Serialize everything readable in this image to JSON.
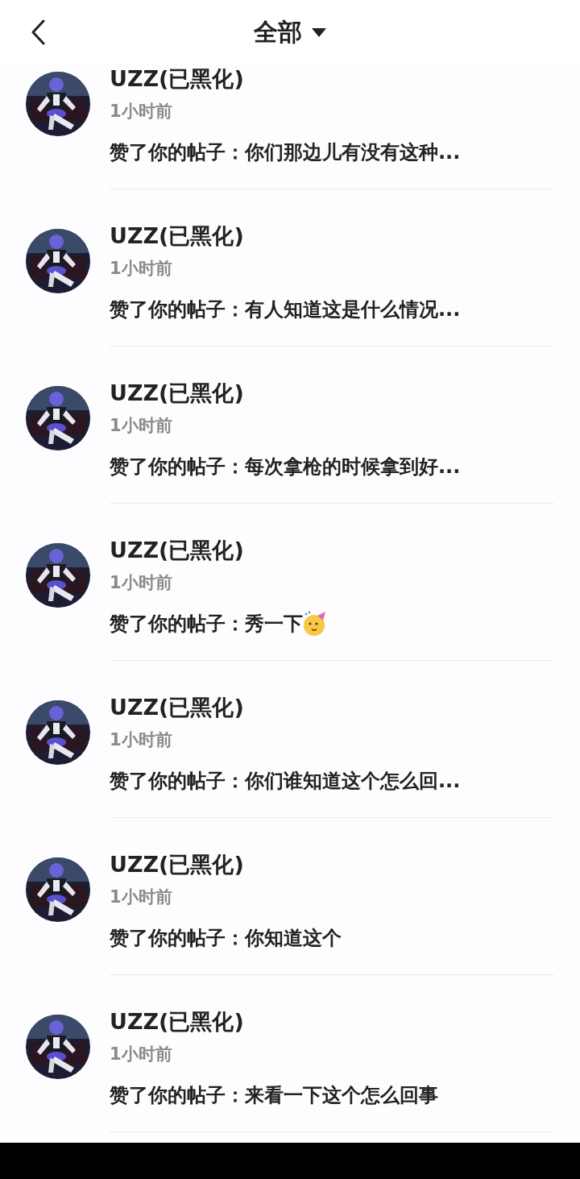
{
  "header": {
    "title": "全部"
  },
  "notifications": [
    {
      "kind": "plain",
      "name": "UZZ(已黑化)",
      "time": "1小时前",
      "text": "赞了你的帖子：你们那边儿有没有这种..."
    },
    {
      "kind": "plain",
      "name": "UZZ(已黑化)",
      "time": "1小时前",
      "text": "赞了你的帖子：有人知道这是什么情况..."
    },
    {
      "kind": "plain",
      "name": "UZZ(已黑化)",
      "time": "1小时前",
      "text": "赞了你的帖子：每次拿枪的时候拿到好..."
    },
    {
      "kind": "emoji",
      "name": "UZZ(已黑化)",
      "time": "1小时前",
      "text": "赞了你的帖子：秀一下"
    },
    {
      "kind": "plain",
      "name": "UZZ(已黑化)",
      "time": "1小时前",
      "text": "赞了你的帖子：你们谁知道这个怎么回..."
    },
    {
      "kind": "plain",
      "name": "UZZ(已黑化)",
      "time": "1小时前",
      "text": "赞了你的帖子：你知道这个"
    },
    {
      "kind": "plain",
      "name": "UZZ(已黑化)",
      "time": "1小时前",
      "text": "赞了你的帖子：来看一下这个怎么回事"
    }
  ]
}
